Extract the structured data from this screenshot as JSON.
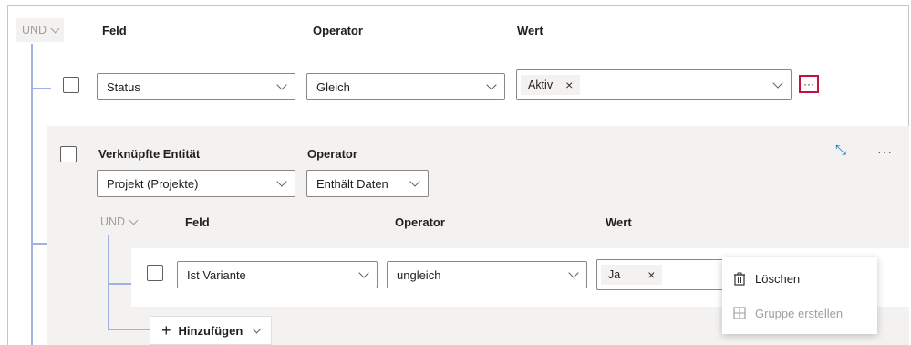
{
  "root_group": {
    "logic": "UND",
    "headers": {
      "field": "Feld",
      "operator": "Operator",
      "value": "Wert"
    },
    "row": {
      "field_value": "Status",
      "operator_value": "Gleich",
      "value_tag": "Aktiv",
      "tag_remove_glyph": "×",
      "more_glyph": "···",
      "highlight_color": "#c4113f"
    }
  },
  "related_entity": {
    "label": "Verknüpfte Entität",
    "operator_label": "Operator",
    "entity_value": "Projekt (Projekte)",
    "operator_value": "Enthält Daten",
    "collapse_glyph": "⤡",
    "more_glyph": "···",
    "nested_group": {
      "logic": "UND",
      "headers": {
        "field": "Feld",
        "operator": "Operator",
        "value": "Wert"
      },
      "row": {
        "field_value": "Ist Variante",
        "operator_value": "ungleich",
        "value_tag": "Ja",
        "tag_remove_glyph": "×"
      },
      "add_button": {
        "label": "Hinzufügen",
        "plus_glyph": "+"
      }
    }
  },
  "context_menu": {
    "items": [
      {
        "label": "Löschen",
        "icon": "trash-icon",
        "disabled": false
      },
      {
        "label": "Gruppe erstellen",
        "icon": "group-icon",
        "disabled": true
      }
    ]
  },
  "colors": {
    "connector": "#9fb2e3",
    "panel_gray": "#f3f2f1",
    "highlight": "#c4113f",
    "accent_blue": "#0078d4"
  }
}
